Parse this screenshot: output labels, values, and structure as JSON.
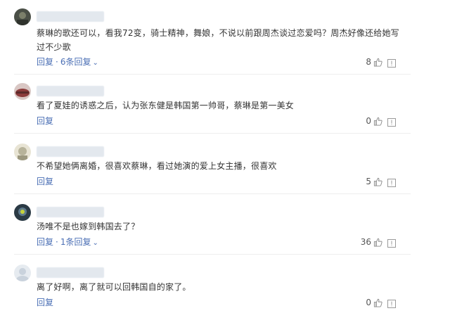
{
  "comments": [
    {
      "text": "蔡琳的歌还可以，看我72变，骑士精神，舞娘，不说以前跟周杰谈过恋爱吗？周杰好像还给她写过不少歌",
      "reply_label": "回复",
      "replies_label": "6条回复",
      "like_count": "8",
      "avatar_color": "#4a4f46"
    },
    {
      "text": "看了夏娃的诱惑之后，认为张东健是韩国第一帅哥，蔡琳是第一美女",
      "reply_label": "回复",
      "replies_label": "",
      "like_count": "0",
      "avatar_color": "#8c3b3b"
    },
    {
      "text": "不希望她俩离婚，很喜欢蔡琳，看过她演的爱上女主播，很喜欢",
      "reply_label": "回复",
      "replies_label": "",
      "like_count": "5",
      "avatar_color": "#b7b39a"
    },
    {
      "text": "汤唯不是也嫁到韩国去了？",
      "reply_label": "回复",
      "replies_label": "1条回复",
      "like_count": "36",
      "avatar_color": "#3b4f5e"
    },
    {
      "text": "离了好啊，离了就可以回韩国自的家了。",
      "reply_label": "回复",
      "replies_label": "",
      "like_count": "0",
      "avatar_color": "#c9d2dc"
    }
  ],
  "colors": {
    "link": "#4b6fb5",
    "text": "#333333",
    "divider": "#eeeeee"
  },
  "icons": {
    "like": "thumbs-up-icon",
    "report": "report-icon",
    "expand": "chevron-down-icon"
  }
}
